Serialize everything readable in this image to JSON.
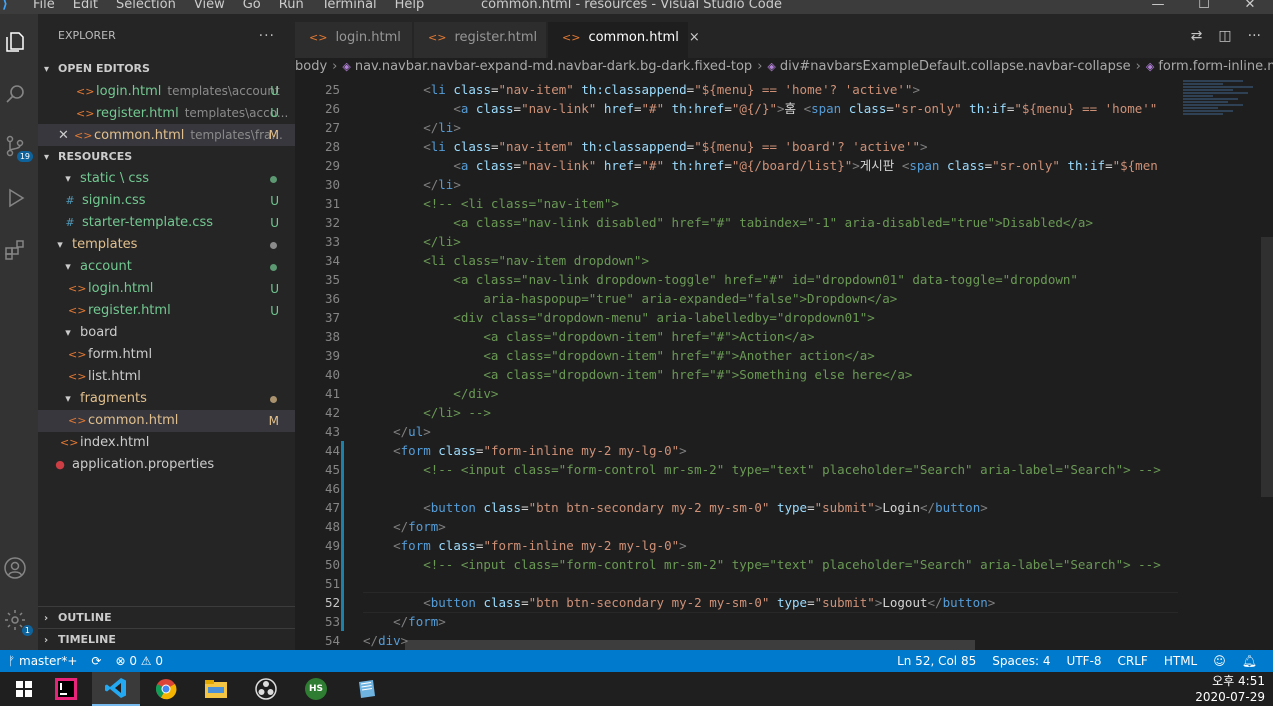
{
  "titlebar": {
    "menu": [
      "File",
      "Edit",
      "Selection",
      "View",
      "Go",
      "Run",
      "Terminal",
      "Help"
    ],
    "title": "common.html - resources - Visual Studio Code"
  },
  "activity_bar": {
    "scm_badge": "19",
    "settings_badge": "1"
  },
  "explorer": {
    "header": "EXPLORER",
    "more": "···",
    "open_editors_label": "OPEN EDITORS",
    "open_editors": [
      {
        "name": "login.html",
        "path": "templates\\account",
        "status": "U"
      },
      {
        "name": "register.html",
        "path": "templates\\acco...",
        "status": "U"
      },
      {
        "name": "common.html",
        "path": "templates\\fra...",
        "status": "M"
      }
    ],
    "resources_label": "RESOURCES",
    "tree": {
      "static": "static \\ css",
      "signin": "signin.css",
      "starter": "starter-template.css",
      "templates": "templates",
      "account": "account",
      "login": "login.html",
      "register": "register.html",
      "board": "board",
      "form": "form.html",
      "list": "list.html",
      "fragments": "fragments",
      "common": "common.html",
      "index": "index.html",
      "application": "application.properties"
    },
    "status_u": "U",
    "status_m": "M",
    "outline_label": "OUTLINE",
    "timeline_label": "TIMELINE"
  },
  "tabs": [
    {
      "label": "login.html",
      "active": false
    },
    {
      "label": "register.html",
      "active": false
    },
    {
      "label": "common.html",
      "active": true
    }
  ],
  "tab_close": "×",
  "breadcrumb": [
    "body",
    "nav.navbar.navbar-expand-md.navbar-dark.bg-dark.fixed-top",
    "div#navbarsExampleDefault.collapse.navbar-collapse",
    "form.form-inline.my-2.my-lg-0"
  ],
  "editor": {
    "line_numbers": [
      "25",
      "26",
      "27",
      "28",
      "29",
      "30",
      "31",
      "32",
      "33",
      "34",
      "35",
      "36",
      "37",
      "38",
      "39",
      "40",
      "41",
      "42",
      "43",
      "44",
      "45",
      "46",
      "47",
      "48",
      "49",
      "50",
      "51",
      "52",
      "53",
      "54"
    ],
    "current_line": "52"
  },
  "statusbar": {
    "branch": "master*+",
    "sync": "⟳",
    "errors": "⊗ 0 ⚠ 0",
    "position": "Ln 52, Col 85",
    "spaces": "Spaces: 4",
    "encoding": "UTF-8",
    "eol": "CRLF",
    "language": "HTML"
  },
  "taskbar": {
    "time": "오후 4:51",
    "date": "2020-07-29",
    "hs_label": "HS"
  },
  "colors": {
    "statusbar": "#007acc",
    "activitybar": "#333333",
    "sidebar": "#252526",
    "editor": "#1e1e1e"
  }
}
